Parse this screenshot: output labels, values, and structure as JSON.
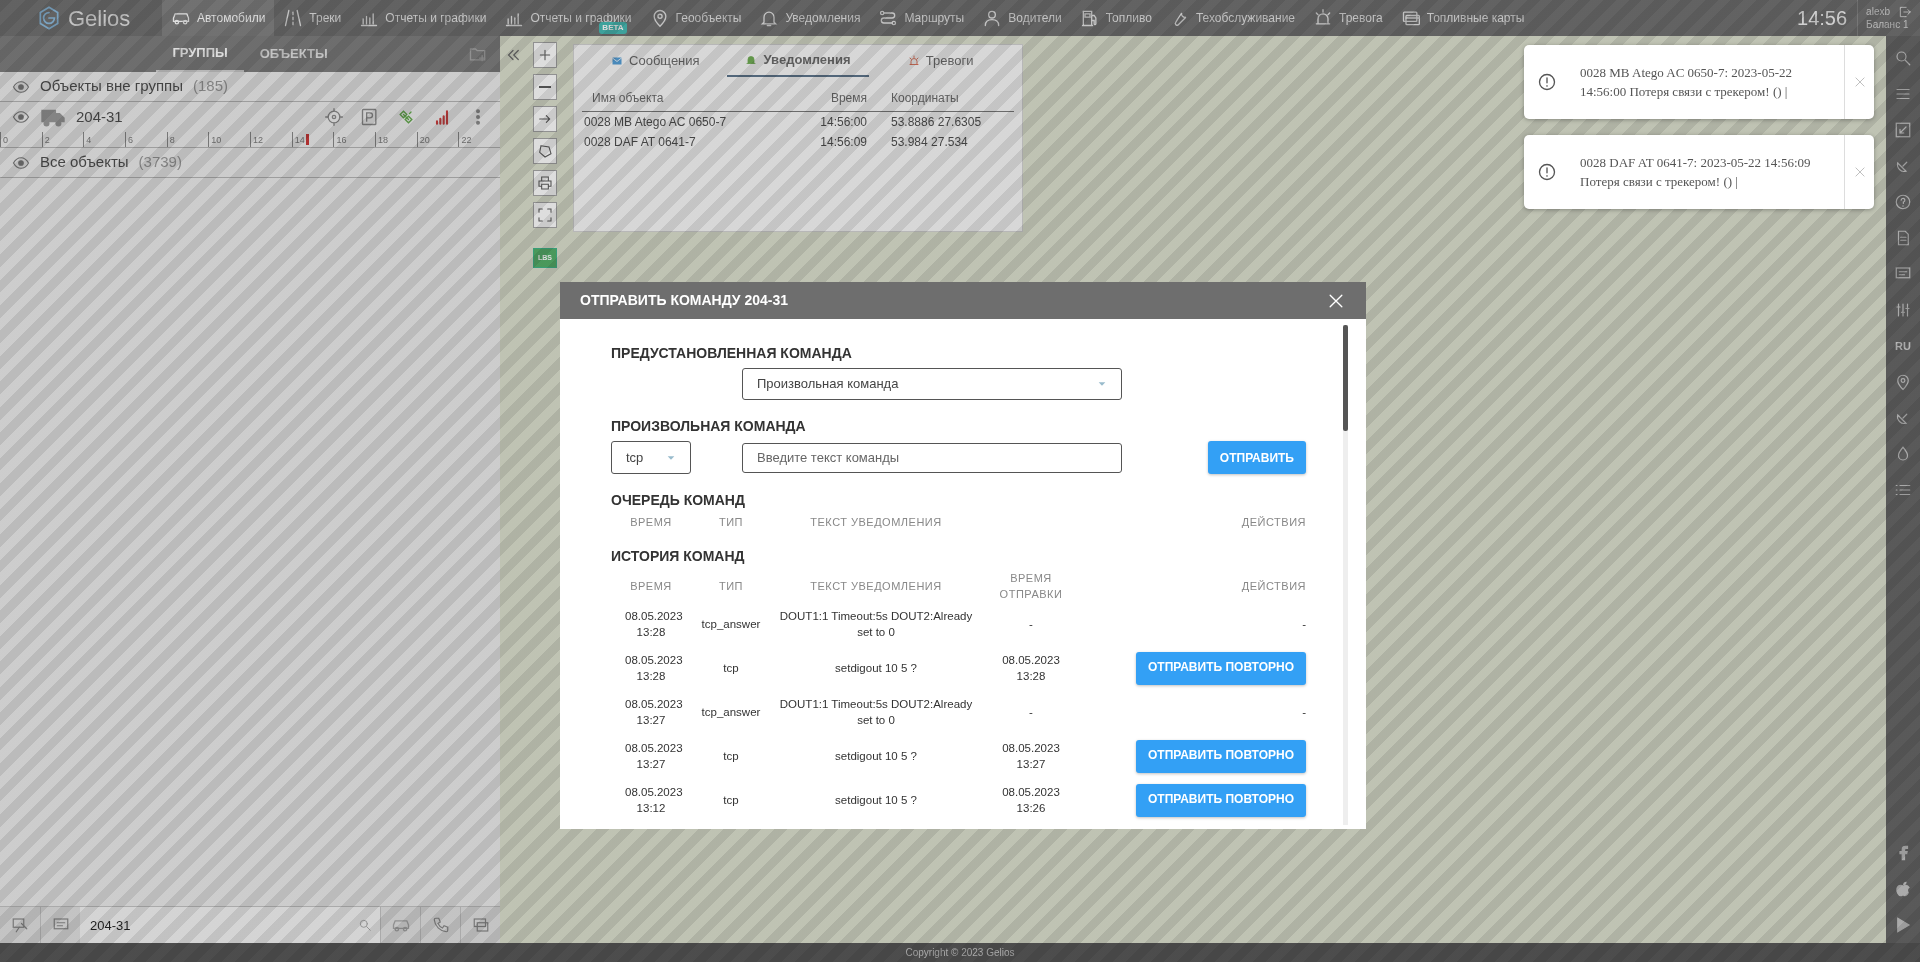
{
  "top_nav": {
    "logo": "Gelios",
    "items": [
      {
        "label": "Автомобили",
        "selected": true
      },
      {
        "label": "Треки",
        "selected": false
      },
      {
        "label": "Отчеты и графики",
        "selected": false
      },
      {
        "label": "Отчеты и графики",
        "selected": false,
        "badge": "BETA"
      },
      {
        "label": "Геообъекты",
        "selected": false
      },
      {
        "label": "Уведомления",
        "selected": false
      },
      {
        "label": "Маршруты",
        "selected": false
      },
      {
        "label": "Водители",
        "selected": false
      },
      {
        "label": "Топливо",
        "selected": false
      },
      {
        "label": "Техобслуживание",
        "selected": false
      },
      {
        "label": "Тревога",
        "selected": false
      },
      {
        "label": "Топливные карты",
        "selected": false
      }
    ],
    "clock": "14:56",
    "user": "alexb",
    "balance": "Баланс 1"
  },
  "left_panel": {
    "tabs": [
      {
        "label": "ГРУППЫ",
        "selected": true
      },
      {
        "label": "ОБЪЕКТЫ",
        "selected": false
      }
    ],
    "rows": [
      {
        "kind": "group",
        "name": "Объекты вне группы",
        "count": "(185)"
      },
      {
        "kind": "object",
        "name": "204-31",
        "timeline": {
          "ticks": [
            "0",
            "2",
            "4",
            "6",
            "8",
            "10",
            "12",
            "14",
            "16",
            "18",
            "20",
            "22"
          ],
          "level": 0.612
        }
      },
      {
        "kind": "group",
        "name": "Все объекты",
        "count": "(3739)"
      }
    ],
    "search": {
      "value": "204-31"
    }
  },
  "map_tools": {
    "lbs_label": "LBS"
  },
  "notifications_panel": {
    "tabs": [
      {
        "label": "Сообщения",
        "selected": false
      },
      {
        "label": "Уведомления",
        "selected": true
      },
      {
        "label": "Тревоги",
        "selected": false
      }
    ],
    "columns": [
      "Имя объекта",
      "Время",
      "Координаты"
    ],
    "rows": [
      [
        "0028 MB Atego AC 0650-7",
        "14:56:00",
        "53.8886 27.6305"
      ],
      [
        "0028 DAF AT 0641-7",
        "14:56:09",
        "53.984 27.534"
      ]
    ]
  },
  "toasts": [
    {
      "text": "0028 MB Atego AC 0650-7: 2023-05-22 14:56:00 Потеря связи с трекером! () |"
    },
    {
      "text": "0028 DAF AT 0641-7: 2023-05-22 14:56:09 Потеря связи с трекером! () |"
    }
  ],
  "right_toolbar": {
    "language": "RU"
  },
  "modal": {
    "title": "ОТПРАВИТЬ КОМАНДУ 204-31",
    "preset_label": "ПРЕДУСТАНОВЛЕННАЯ КОМАНДА",
    "preset_value": "Произвольная команда",
    "custom_label": "ПРОИЗВОЛЬНАЯ КОМАНДА",
    "type_value": "tcp",
    "command_placeholder": "Введите текст команды",
    "send_button": "ОТПРАВИТЬ",
    "queue": {
      "title": "ОЧЕРЕДЬ КОМАНД",
      "columns": [
        "ВРЕМЯ",
        "ТИП",
        "ТЕКСТ УВЕДОМЛЕНИЯ",
        "",
        "ДЕЙСТВИЯ"
      ]
    },
    "history": {
      "title": "ИСТОРИЯ КОМАНД",
      "columns": [
        "ВРЕМЯ",
        "ТИП",
        "ТЕКСТ УВЕДОМЛЕНИЯ",
        "ВРЕМЯ ОТПРАВКИ",
        "ДЕЙСТВИЯ"
      ],
      "rows": [
        {
          "kind": "text",
          "time": "08.05.2023 13:28",
          "type": "tcp_answer",
          "text": "DOUT1:1 Timeout:5s DOUT2:Already set to 0",
          "sent": "-",
          "action": "-"
        },
        {
          "kind": "button",
          "time": "08.05.2023 13:28",
          "type": "tcp",
          "text": "setdigout 10 5 ?",
          "sent": "08.05.2023 13:28",
          "action": "ОТПРАВИТЬ ПОВТОРНО"
        },
        {
          "kind": "text",
          "time": "08.05.2023 13:27",
          "type": "tcp_answer",
          "text": "DOUT1:1 Timeout:5s DOUT2:Already set to 0",
          "sent": "-",
          "action": "-"
        },
        {
          "kind": "button",
          "time": "08.05.2023 13:27",
          "type": "tcp",
          "text": "setdigout 10 5 ?",
          "sent": "08.05.2023 13:27",
          "action": "ОТПРАВИТЬ ПОВТОРНО"
        },
        {
          "kind": "button",
          "time": "08.05.2023 13:12",
          "type": "tcp",
          "text": "setdigout 10 5 ?",
          "sent": "08.05.2023 13:26",
          "action": "ОТПРАВИТЬ ПОВТОРНО"
        }
      ]
    }
  },
  "footer": "Copyright © 2023 Gelios"
}
